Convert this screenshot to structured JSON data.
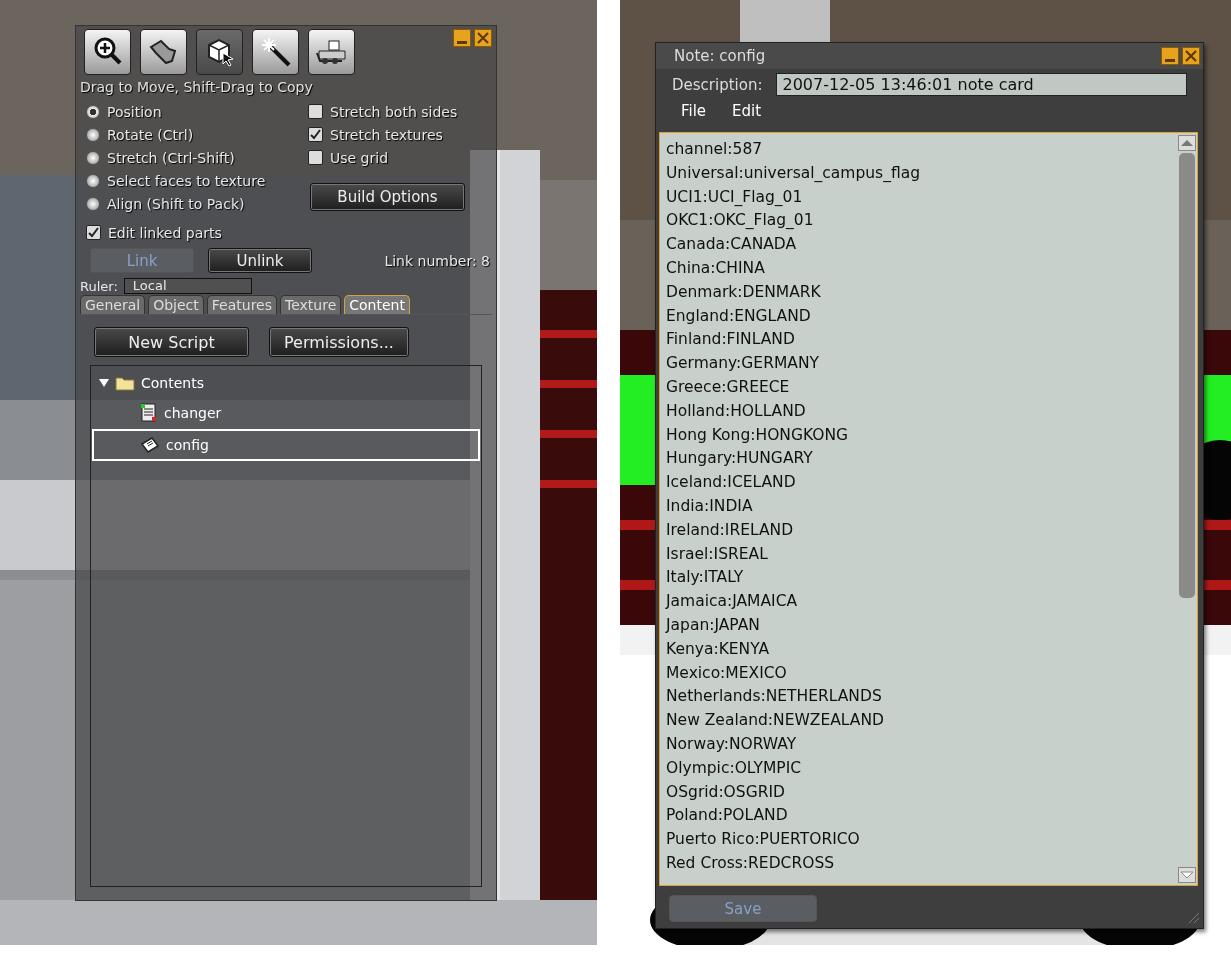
{
  "build_panel": {
    "tools": [
      {
        "selected": false
      },
      {
        "selected": false
      },
      {
        "selected": true
      },
      {
        "selected": false
      },
      {
        "selected": false
      }
    ],
    "hint": "Drag to Move, Shift-Drag to Copy",
    "modes": [
      {
        "label": "Position",
        "selected": true
      },
      {
        "label": "Rotate (Ctrl)",
        "selected": false
      },
      {
        "label": "Stretch (Ctrl-Shift)",
        "selected": false
      },
      {
        "label": "Select faces to texture",
        "selected": false
      },
      {
        "label": "Align (Shift to Pack)",
        "selected": false
      }
    ],
    "options": [
      {
        "label": "Stretch both sides",
        "checked": false
      },
      {
        "label": "Stretch textures",
        "checked": true
      },
      {
        "label": "Use grid",
        "checked": false
      }
    ],
    "build_options_button": "Build Options",
    "edit_linked": {
      "label": "Edit linked parts",
      "checked": true
    },
    "link_button": {
      "label": "Link",
      "disabled": true
    },
    "unlink_button": {
      "label": "Unlink",
      "disabled": false
    },
    "link_number": "Link number: 8",
    "ruler": {
      "label": "Ruler:",
      "value": "Local"
    },
    "tabs": [
      {
        "label": "General",
        "selected": false
      },
      {
        "label": "Object",
        "selected": false
      },
      {
        "label": "Features",
        "selected": false
      },
      {
        "label": "Texture",
        "selected": false
      },
      {
        "label": "Content",
        "selected": true
      }
    ],
    "buttons": [
      "New Script",
      "Permissions..."
    ],
    "tree": {
      "label": "Contents",
      "expanded": true,
      "children": [
        {
          "label": "changer",
          "kind": "script",
          "selected": false
        },
        {
          "label": "config",
          "kind": "notecard",
          "selected": true
        }
      ]
    }
  },
  "note_window": {
    "title": "Note: config",
    "description_label": "Description:",
    "description": "2007-12-05 13:46:01 note card",
    "menu": [
      "File",
      "Edit"
    ],
    "lines": [
      "channel:587",
      "Universal:universal_campus_flag",
      "UCI1:UCI_Flag_01",
      "OKC1:OKC_Flag_01",
      "Canada:CANADA",
      "China:CHINA",
      "Denmark:DENMARK",
      "England:ENGLAND",
      "Finland:FINLAND",
      "Germany:GERMANY",
      "Greece:GREECE",
      "Holland:HOLLAND",
      "Hong Kong:HONGKONG",
      "Hungary:HUNGARY",
      "Iceland:ICELAND",
      "India:INDIA",
      "Ireland:IRELAND",
      "Israel:ISREAL",
      "Italy:ITALY",
      "Jamaica:JAMAICA",
      "Japan:JAPAN",
      "Kenya:KENYA",
      "Mexico:MEXICO",
      "Netherlands:NETHERLANDS",
      "New Zealand:NEWZEALAND",
      "Norway:NORWAY",
      "Olympic:OLYMPIC",
      "OSgrid:OSGRID",
      "Poland:POLAND",
      "Puerto Rico:PUERTORICO",
      "Red Cross:REDCROSS"
    ],
    "save_button": {
      "label": "Save",
      "disabled": true
    }
  }
}
